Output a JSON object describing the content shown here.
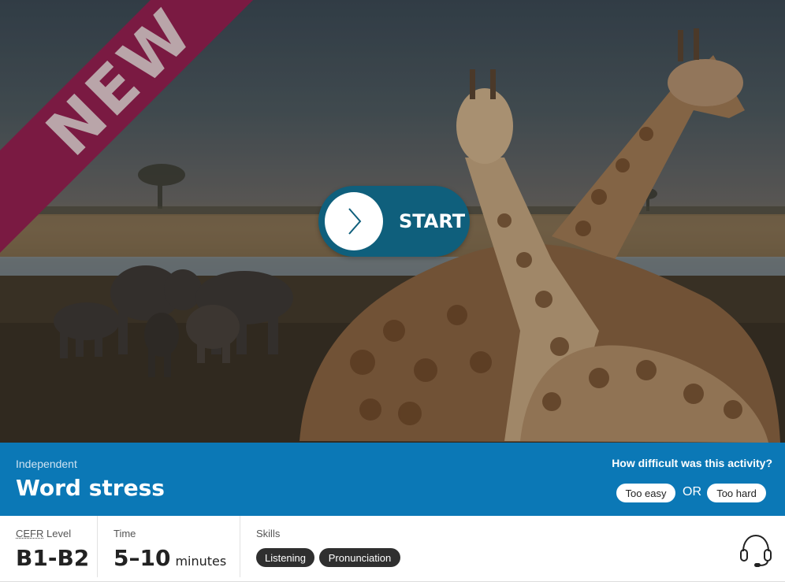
{
  "hero": {
    "ribbon_text": "NEW",
    "start_label": "START",
    "image_subject": "giraffes-and-elephants-savanna"
  },
  "activity": {
    "category": "Independent",
    "title": "Word stress"
  },
  "feedback": {
    "question": "How difficult was this activity?",
    "too_easy": "Too easy",
    "or": "OR",
    "too_hard": "Too hard"
  },
  "meta": {
    "level_label_abbr": "CEFR",
    "level_label_rest": " Level",
    "level_value": "B1-B2",
    "time_label": "Time",
    "time_value": "5–10",
    "time_units": "minutes",
    "skills_label": "Skills",
    "skills": [
      "Listening",
      "Pronunciation"
    ]
  },
  "icons": {
    "start": "chevron-right-icon",
    "support": "headset-icon"
  },
  "colors": {
    "ribbon": "#7a1a42",
    "start_button": "#0f5f7c",
    "info_bar": "#0b78b6",
    "skill_pill": "#2f2f2f"
  }
}
